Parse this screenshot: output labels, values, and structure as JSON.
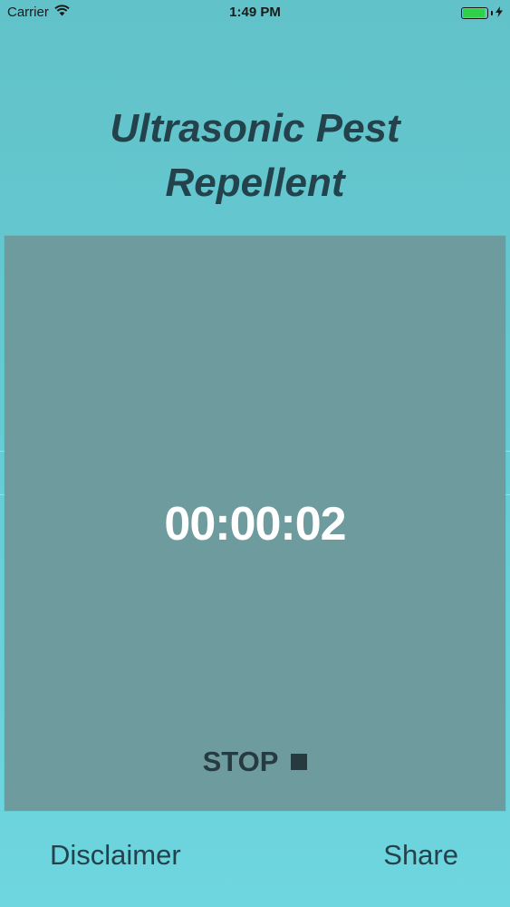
{
  "status_bar": {
    "carrier": "Carrier",
    "time": "1:49 PM",
    "battery_level": 0.95,
    "battery_color": "#2fd14a",
    "wifi_icon": "wifi-icon",
    "charging_icon": "bolt-icon"
  },
  "header": {
    "title_line1": "Ultrasonic Pest",
    "title_line2": "Repellent"
  },
  "timer": {
    "value": "00:00:02",
    "stop_label": "STOP"
  },
  "footer": {
    "disclaimer_label": "Disclaimer",
    "share_label": "Share"
  },
  "colors": {
    "background": "#66cbd4",
    "panel": "#6e9c9e",
    "text_dark": "#24424b"
  }
}
